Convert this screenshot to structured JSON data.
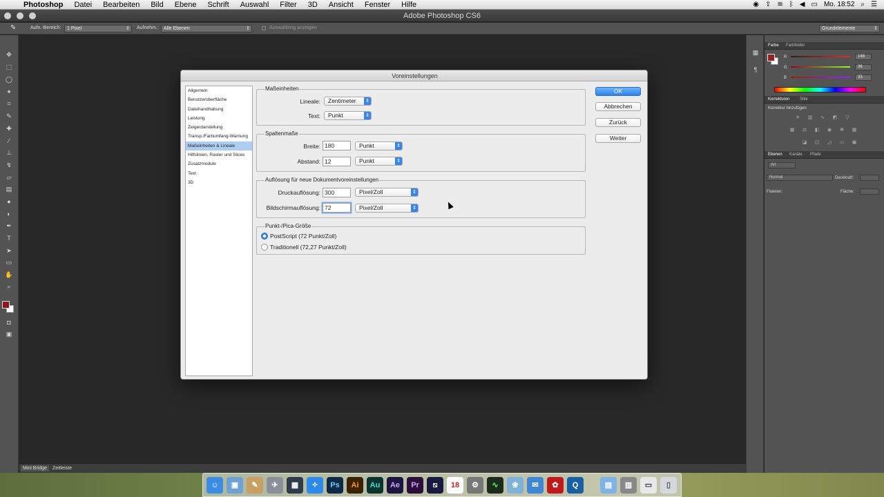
{
  "menubar": {
    "app": "Photoshop",
    "items": [
      "Datei",
      "Bearbeiten",
      "Bild",
      "Ebene",
      "Schrift",
      "Auswahl",
      "Filter",
      "3D",
      "Ansicht",
      "Fenster",
      "Hilfe"
    ],
    "clock": "Mo. 18:52"
  },
  "window": {
    "title": "Adobe Photoshop CS6"
  },
  "optionsbar": {
    "sample_size_label": "Aufn.-Bereich:",
    "sample_size_value": "1 Pixel",
    "sample_label": "Aufnehm.:",
    "sample_value": "Alle Ebenen",
    "ring_label": "Auswahlring anzeigen",
    "workspace": "Grundelemente"
  },
  "bottom_tabs": [
    "Mini Bridge",
    "Zeitleiste"
  ],
  "panels": {
    "color": {
      "tabs": [
        "Farbe",
        "Farbfelder"
      ],
      "r_label": "R",
      "r_value": "148",
      "g_label": "G",
      "g_value": "36",
      "b_label": "B",
      "b_value": "33",
      "foreground_color": "#942421"
    },
    "adjustments": {
      "tabs": [
        "Korrekturen",
        "Stile"
      ],
      "heading": "Korrektur hinzufügen"
    },
    "layers": {
      "tabs": [
        "Ebenen",
        "Kanäle",
        "Pfade"
      ],
      "kind_filter": "Art",
      "blend_mode": "Normal",
      "opacity_label": "Deckkraft:",
      "lock_label": "Fixieren:",
      "fill_label": "Fläche:"
    }
  },
  "dialog": {
    "title": "Voreinstellungen",
    "categories": [
      "Allgemein",
      "Benutzeroberfläche",
      "Dateihandhabung",
      "Leistung",
      "Zeigerdarstellung",
      "Transp./Farbumfang-Warnung",
      "Maßeinheiten & Lineale",
      "Hilfslinien, Raster und Slices",
      "Zusatzmodule",
      "Text",
      "3D"
    ],
    "selected_category": "Maßeinheiten & Lineale",
    "units": {
      "title": "Maßeinheiten",
      "rulers_label": "Lineale:",
      "rulers_value": "Zentimeter",
      "type_label": "Text:",
      "type_value": "Punkt"
    },
    "columns": {
      "title": "Spaltenmaße",
      "width_label": "Breite:",
      "width_value": "180",
      "width_unit": "Punkt",
      "gutter_label": "Abstand:",
      "gutter_value": "12",
      "gutter_unit": "Punkt"
    },
    "resolution": {
      "title": "Auflösung für neue Dokumentvoreinstellungen",
      "print_label": "Druckauflösung:",
      "print_value": "300",
      "print_unit": "Pixel/Zoll",
      "screen_label": "Bildschirmauflösung:",
      "screen_value": "72",
      "screen_unit": "Pixel/Zoll"
    },
    "point_size": {
      "title": "Punkt-/Pica-Größe",
      "postscript_label": "PostScript (72 Punkt/Zoll)",
      "traditional_label": "Traditionell (72,27 Punkt/Zoll)",
      "selected": "PostScript (72 Punkt/Zoll)"
    },
    "buttons": {
      "ok": "OK",
      "cancel": "Abbrechen",
      "back": "Zurück",
      "next": "Weiter"
    }
  },
  "dock": {
    "apps": [
      "Finder",
      "Vorschau",
      "Notizen",
      "Launchpad",
      "Monitor",
      "Safari",
      "Ps",
      "Ai",
      "Au",
      "Ae",
      "Pr",
      "Media Encoder",
      "18",
      "Systemeinstellungen",
      "Aktivitätsanzeige",
      "Fotos",
      "Mail",
      "Acrobat",
      "QuickTime",
      "Downloads",
      "Drucker",
      "Dokumente",
      "Papierkorb"
    ],
    "calendar_day": "18"
  }
}
